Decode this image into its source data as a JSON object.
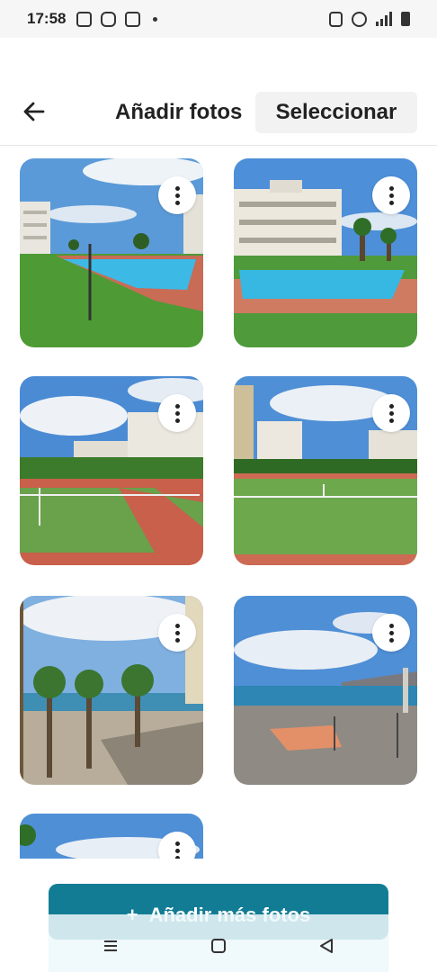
{
  "status_bar": {
    "time": "17:58",
    "left_icons": [
      "gallery-icon",
      "instagram-icon",
      "square-icon",
      "dot-icon"
    ],
    "right_icons": [
      "nfc-icon",
      "alarm-icon",
      "signal-icon",
      "battery-icon"
    ]
  },
  "header": {
    "back_icon": "arrow-left-icon",
    "title": "Añadir fotos",
    "select_label": "Seleccionar"
  },
  "photos": [
    {
      "name": "photo-pool-1",
      "scene": "pool"
    },
    {
      "name": "photo-pool-2",
      "scene": "pool"
    },
    {
      "name": "photo-tennis-1",
      "scene": "tennis"
    },
    {
      "name": "photo-tennis-2",
      "scene": "tennis"
    },
    {
      "name": "photo-palms",
      "scene": "palms"
    },
    {
      "name": "photo-beach",
      "scene": "beach"
    },
    {
      "name": "photo-sky",
      "scene": "sky"
    }
  ],
  "add_button": {
    "icon": "+",
    "label": "Añadir más fotos"
  },
  "nav_bar": {
    "items": [
      "recents-icon",
      "home-icon",
      "back-icon"
    ]
  },
  "colors": {
    "primary": "#137c95",
    "sky": "#4f8fd6",
    "grass": "#4f9a3a",
    "pool": "#35b7e0",
    "court": "#cc5a45"
  }
}
